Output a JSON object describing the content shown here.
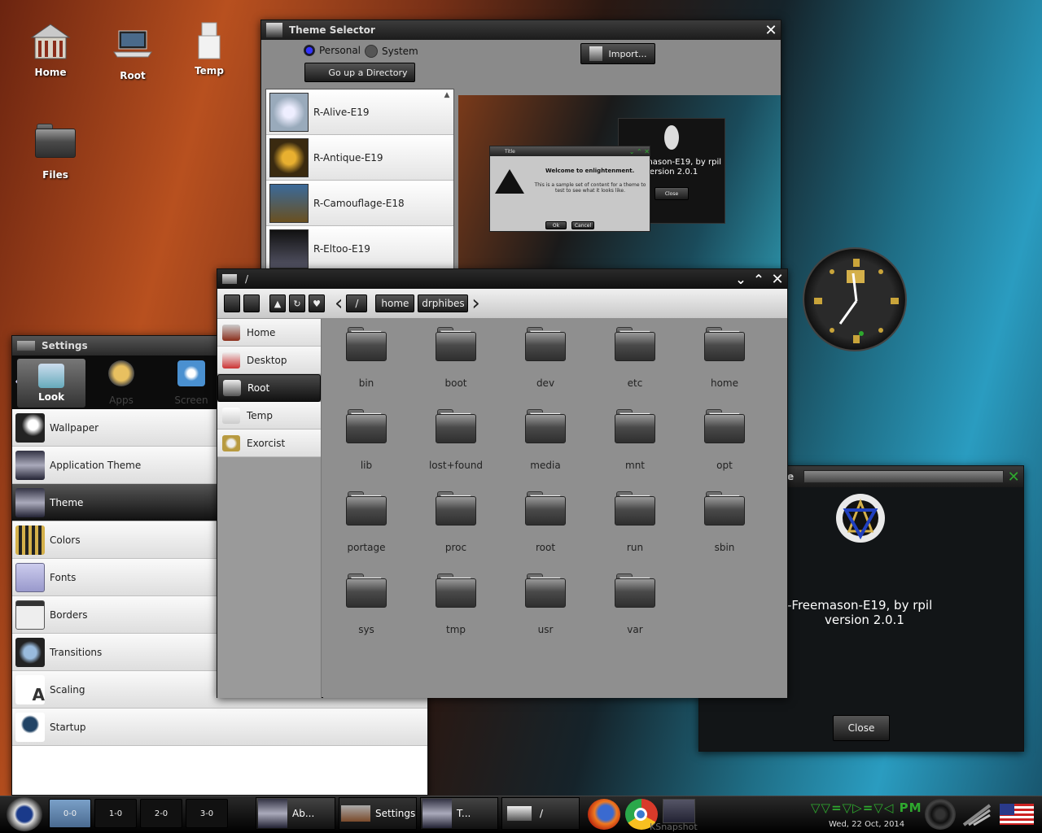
{
  "desktop": {
    "icons": [
      {
        "label": "Home"
      },
      {
        "label": "Root"
      },
      {
        "label": "Temp"
      },
      {
        "label": "Files"
      }
    ]
  },
  "theme_selector": {
    "title": "Theme Selector",
    "radio_personal": "Personal",
    "radio_system": "System",
    "go_up": "Go up a Directory",
    "import": "Import...",
    "themes": [
      "R-Alive-E19",
      "R-Antique-E19",
      "R-Camouflage-E18",
      "R-Eltoo-E19"
    ],
    "preview": {
      "dialog_title": "Title",
      "dialog_heading": "Welcome to enlightenment.",
      "dialog_text": "This is a sample set of content for a theme to test to see what it looks like.",
      "ok": "Ok",
      "cancel": "Cancel",
      "about_text": "mason-E19, by rpil",
      "about_version": "version 2.0.1",
      "about_close": "Close"
    }
  },
  "file_manager": {
    "title": "/",
    "breadcrumb": [
      "/",
      "home",
      "drphibes"
    ],
    "sidebar": [
      "Home",
      "Desktop",
      "Root",
      "Temp",
      "Exorcist"
    ],
    "selected_sidebar": "Root",
    "folders": [
      "bin",
      "boot",
      "dev",
      "etc",
      "home",
      "lib",
      "lost+found",
      "media",
      "mnt",
      "opt",
      "portage",
      "proc",
      "root",
      "run",
      "sbin",
      "sys",
      "tmp",
      "usr",
      "var"
    ]
  },
  "settings": {
    "title": "Settings",
    "tabs": [
      "Look",
      "Apps",
      "Screen"
    ],
    "items": [
      "Wallpaper",
      "Application Theme",
      "Theme",
      "Colors",
      "Fonts",
      "Borders",
      "Transitions",
      "Scaling",
      "Startup"
    ],
    "selected": "Theme"
  },
  "about": {
    "title_fragment": "e",
    "line1": "-Freemason-E19, by rpil",
    "line2": "version 2.0.1",
    "close": "Close"
  },
  "taskbar": {
    "desks": [
      "0-0",
      "1-0",
      "2-0",
      "3-0"
    ],
    "tasks": [
      "Ab...",
      "Settings",
      "T...",
      "/"
    ],
    "ksnap": "KSnapshot",
    "clock_glyphs": "▽▽=▽▷=▽◁ PM",
    "date": "Wed, 22 Oct, 2014"
  },
  "colors": {
    "accent": "#2ea82e",
    "dark": "#1a1a1a"
  }
}
